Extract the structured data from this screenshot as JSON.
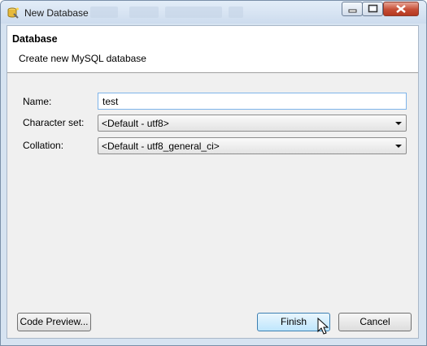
{
  "window": {
    "title": "New Database",
    "icon": "database-wizard-icon"
  },
  "title_controls": {
    "minimize_icon": "minimize-icon",
    "maximize_icon": "maximize-icon",
    "close_icon": "close-icon"
  },
  "header": {
    "title": "Database",
    "description": "Create new MySQL database"
  },
  "form": {
    "name_label": "Name:",
    "name_value": "test",
    "charset_label": "Character set:",
    "charset_value": "<Default - utf8>",
    "collation_label": "Collation:",
    "collation_value": "<Default - utf8_general_ci>"
  },
  "buttons": {
    "code_preview": "Code Preview...",
    "finish": "Finish",
    "cancel": "Cancel"
  },
  "colors": {
    "title_bar": "#d6e3f1",
    "dialog_bg": "#f0f0f0",
    "close_button": "#c64d35",
    "focus_border": "#7eb4ea"
  }
}
